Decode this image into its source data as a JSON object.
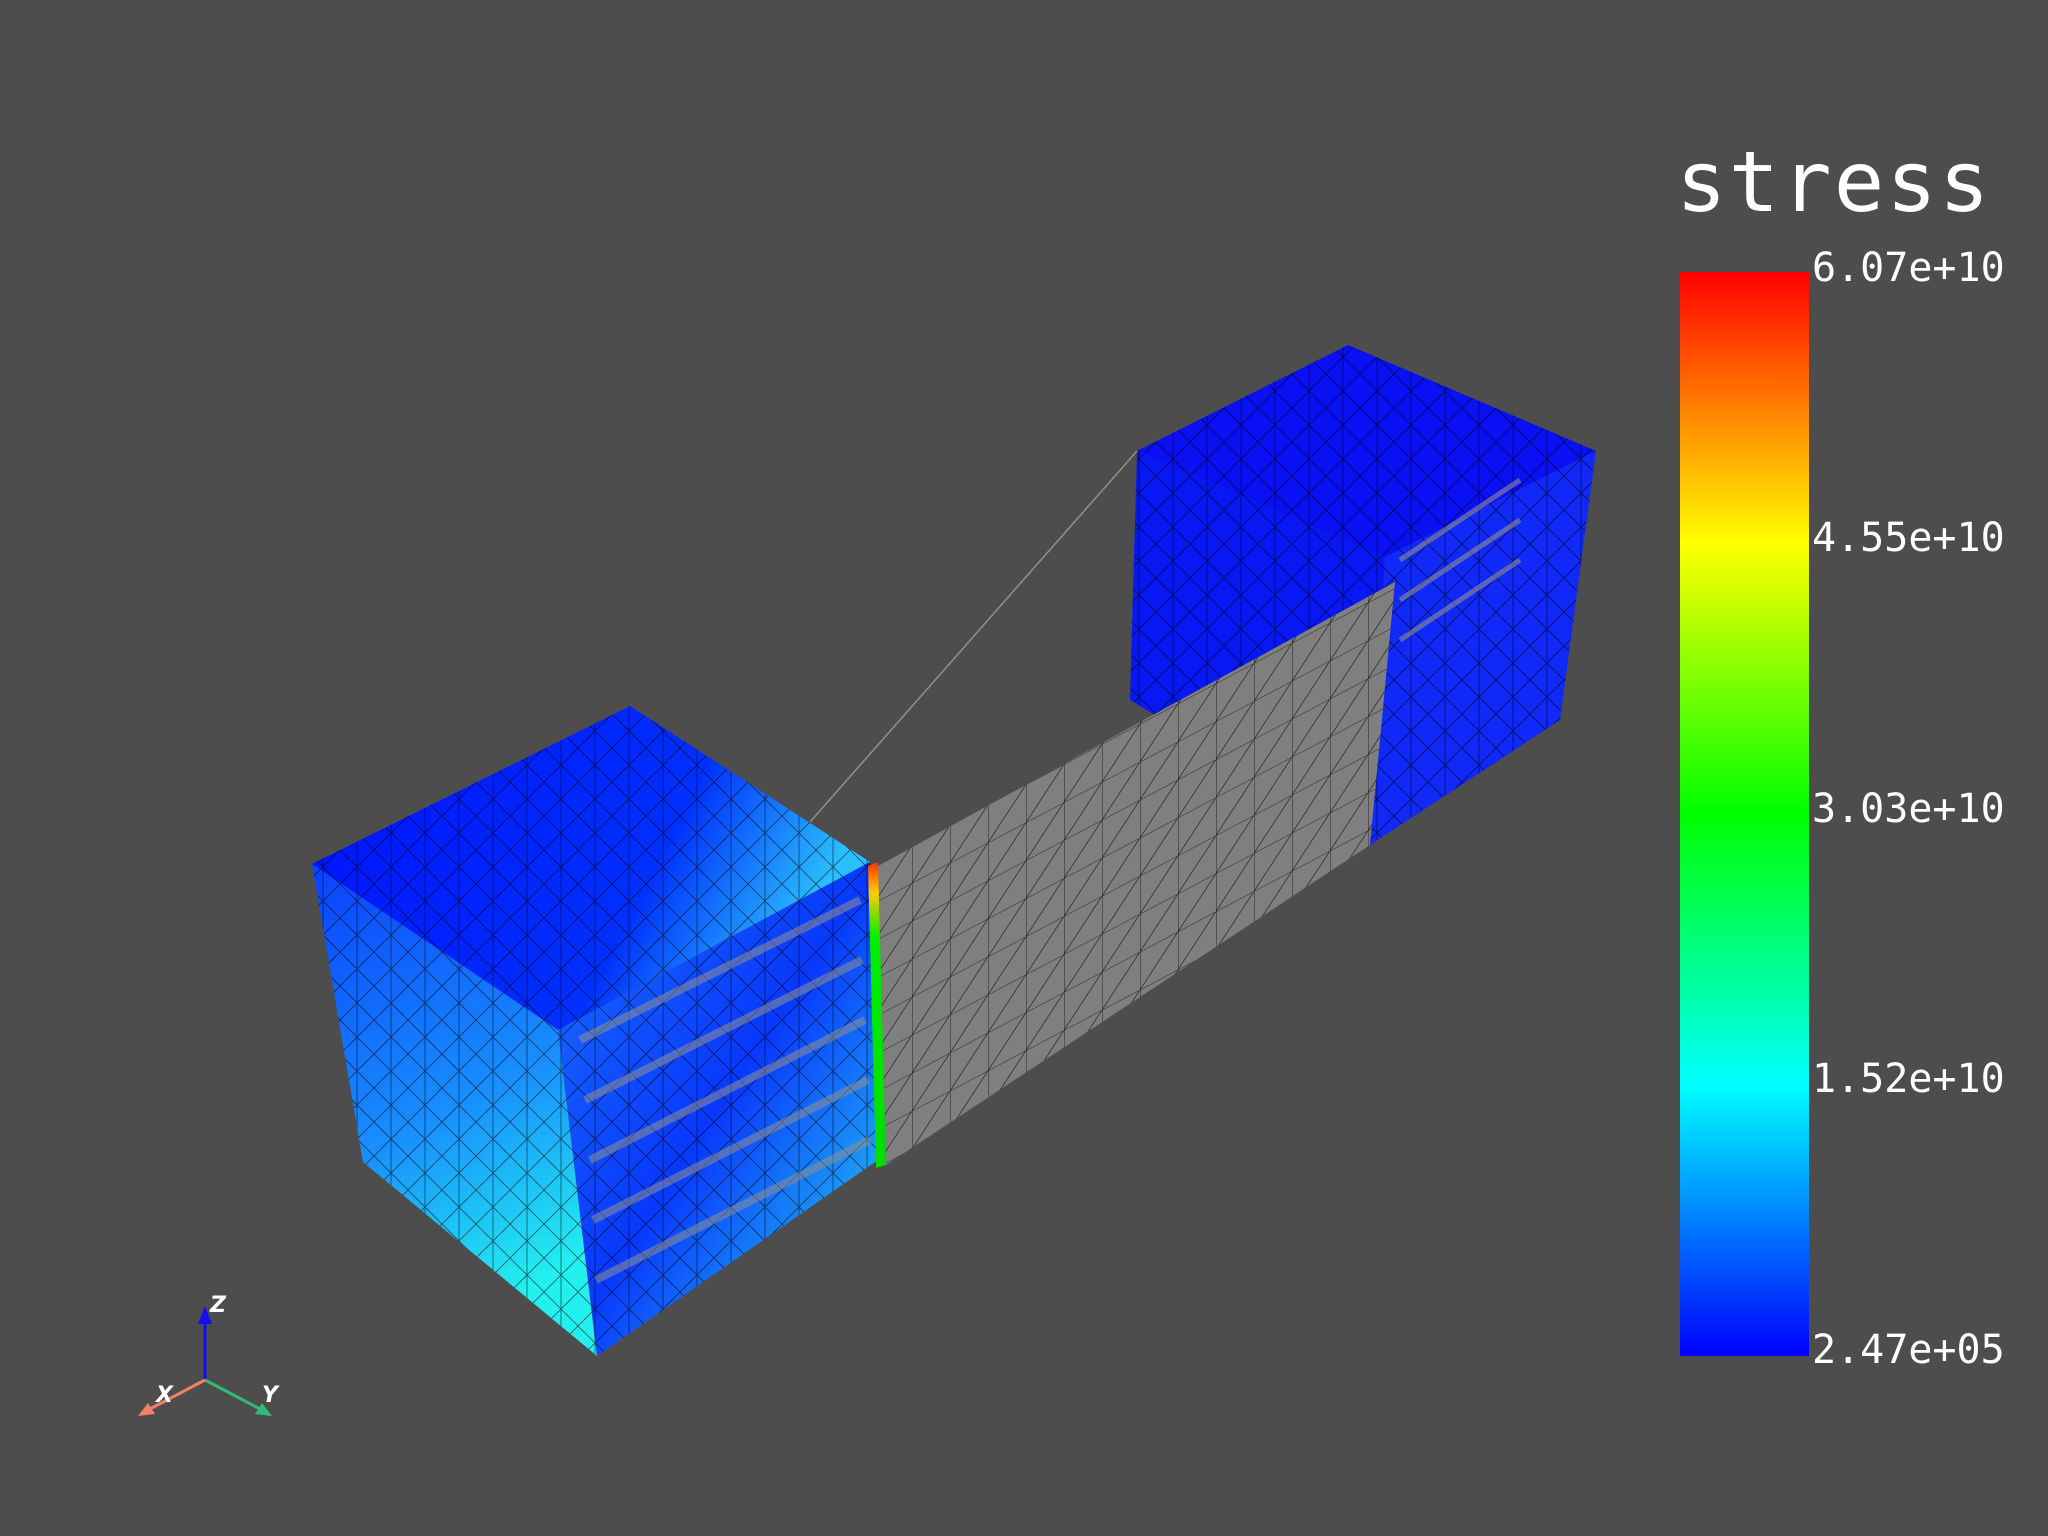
{
  "scalar_bar": {
    "title": "stress",
    "labels": [
      "6.07e+10",
      "4.55e+10",
      "3.03e+10",
      "1.52e+10",
      "2.47e+05"
    ],
    "colormap": "rainbow",
    "colors": [
      "#0000ff",
      "#00ffff",
      "#00ff00",
      "#ffff00",
      "#ff0000"
    ],
    "range": [
      247000,
      60700000000
    ]
  },
  "orientation_axes": {
    "x_label": "X",
    "y_label": "Y",
    "z_label": "Z",
    "x_color": "#f08068",
    "y_color": "#33bb77",
    "z_color": "#1010ee"
  },
  "background_color": "#4d4d4d"
}
